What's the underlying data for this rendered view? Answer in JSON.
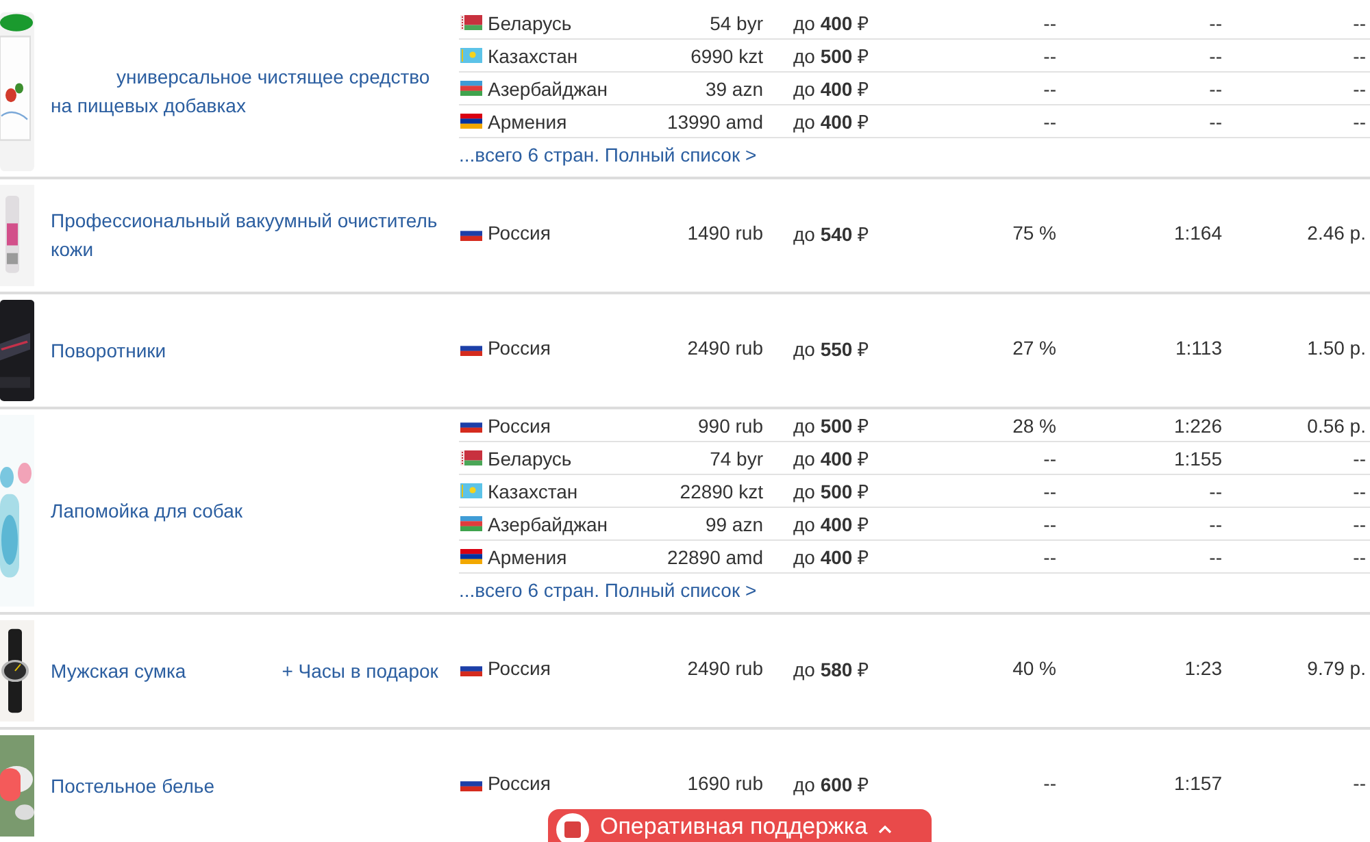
{
  "products": [
    {
      "name_parts": [
        "универсальное чистящее средство на пищевых добавках"
      ],
      "indent": true,
      "countries": [
        {
          "kind": "by",
          "country": "Беларусь",
          "price": "54 byr",
          "limit": "до **400** ₽",
          "percent": "--",
          "ratio": "--",
          "cost": "--"
        },
        {
          "kind": "kz",
          "country": "Казахстан",
          "price": "6990 kzt",
          "limit": "до **500** ₽",
          "percent": "--",
          "ratio": "--",
          "cost": "--"
        },
        {
          "kind": "az",
          "country": "Азербайджан",
          "price": "39 azn",
          "limit": "до **400** ₽",
          "percent": "--",
          "ratio": "--",
          "cost": "--"
        },
        {
          "kind": "am",
          "country": "Армения",
          "price": "13990 amd",
          "limit": "до **400** ₽",
          "percent": "--",
          "ratio": "--",
          "cost": "--"
        }
      ],
      "more_link": "...всего 6 стран. Полный список >"
    },
    {
      "name_parts": [
        "Профессиональный вакуумный очиститель кожи"
      ],
      "indent": false,
      "countries": [
        {
          "kind": "ru",
          "country": "Россия",
          "price": "1490 rub",
          "limit": "до **540** ₽",
          "percent": "75 %",
          "ratio": "1:164",
          "cost": "2.46 р."
        }
      ]
    },
    {
      "name_parts": [
        "Поворотники"
      ],
      "indent": false,
      "countries": [
        {
          "kind": "ru",
          "country": "Россия",
          "price": "2490 rub",
          "limit": "до **550** ₽",
          "percent": "27 %",
          "ratio": "1:113",
          "cost": "1.50 р."
        }
      ]
    },
    {
      "name_parts": [
        "Лапомойка для собак"
      ],
      "indent": false,
      "countries": [
        {
          "kind": "ru",
          "country": "Россия",
          "price": "990 rub",
          "limit": "до **500** ₽",
          "percent": "28 %",
          "ratio": "1:226",
          "cost": "0.56 р."
        },
        {
          "kind": "by",
          "country": "Беларусь",
          "price": "74 byr",
          "limit": "до **400** ₽",
          "percent": "--",
          "ratio": "1:155",
          "cost": "--"
        },
        {
          "kind": "kz",
          "country": "Казахстан",
          "price": "22890 kzt",
          "limit": "до **500** ₽",
          "percent": "--",
          "ratio": "--",
          "cost": "--"
        },
        {
          "kind": "az",
          "country": "Азербайджан",
          "price": "99 azn",
          "limit": "до **400** ₽",
          "percent": "--",
          "ratio": "--",
          "cost": "--"
        },
        {
          "kind": "am",
          "country": "Армения",
          "price": "22890 amd",
          "limit": "до **400** ₽",
          "percent": "--",
          "ratio": "--",
          "cost": "--"
        }
      ],
      "more_link": "...всего 6 стран. Полный список >"
    },
    {
      "name_parts": [
        "Мужская сумка",
        "+ Часы в подарок"
      ],
      "indent": false,
      "countries": [
        {
          "kind": "ru",
          "country": "Россия",
          "price": "2490 rub",
          "limit": "до **580** ₽",
          "percent": "40 %",
          "ratio": "1:23",
          "cost": "9.79 р."
        }
      ]
    },
    {
      "name_parts": [
        "Постельное белье"
      ],
      "indent": false,
      "countries": [
        {
          "kind": "ru",
          "country": "Россия",
          "price": "1690 rub",
          "limit": "до **600** ₽",
          "percent": "--",
          "ratio": "1:157",
          "cost": "--"
        }
      ]
    }
  ],
  "support_button": {
    "label": "Оперативная поддержка"
  }
}
